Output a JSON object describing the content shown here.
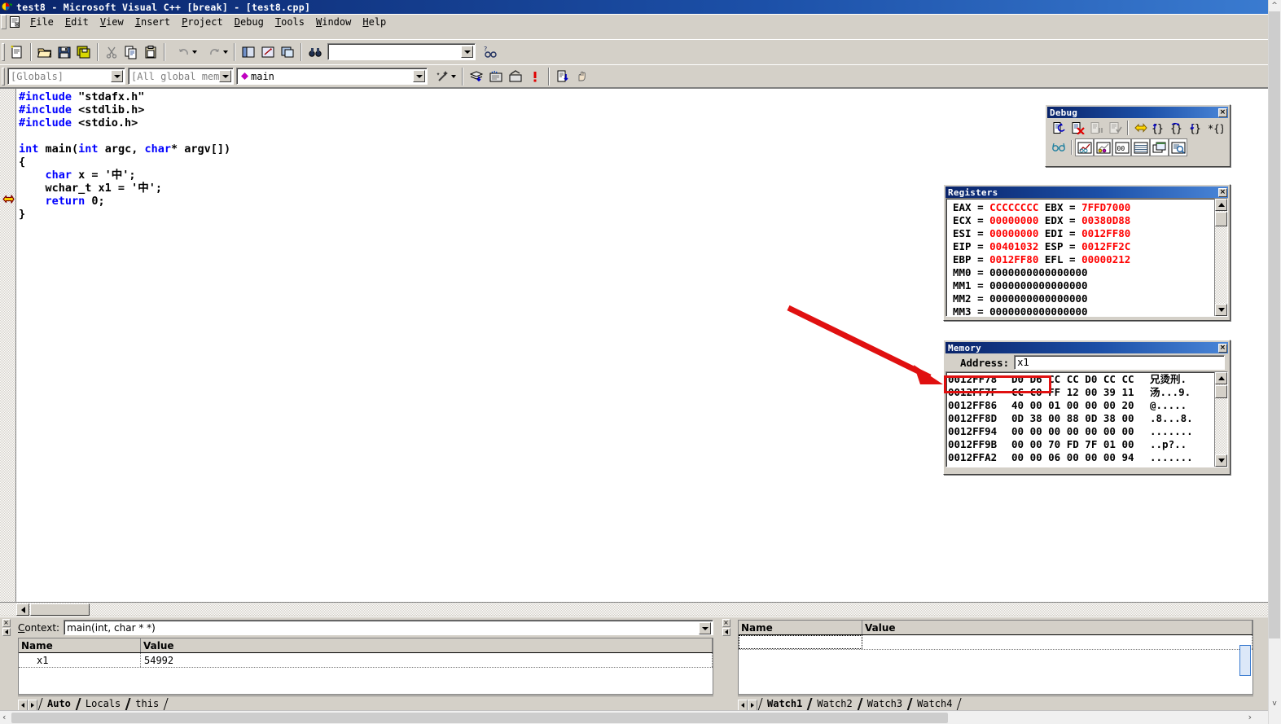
{
  "window": {
    "title": "test8 - Microsoft Visual C++ [break] - [test8.cpp]",
    "app_icon": "vcpp-icon",
    "close_label": "×"
  },
  "menu": {
    "doc_icon": "document-icon",
    "items": [
      {
        "label": "File",
        "mnemonic": "F"
      },
      {
        "label": "Edit",
        "mnemonic": "E"
      },
      {
        "label": "View",
        "mnemonic": "V"
      },
      {
        "label": "Insert",
        "mnemonic": "I"
      },
      {
        "label": "Project",
        "mnemonic": "P"
      },
      {
        "label": "Debug",
        "mnemonic": "D"
      },
      {
        "label": "Tools",
        "mnemonic": "T"
      },
      {
        "label": "Window",
        "mnemonic": "W"
      },
      {
        "label": "Help",
        "mnemonic": "H"
      }
    ]
  },
  "toolbar_standard": {
    "buttons": [
      {
        "name": "new-file-button",
        "icon": "new-document-icon"
      },
      {
        "name": "open-file-button",
        "icon": "open-folder-icon"
      },
      {
        "name": "save-button",
        "icon": "floppy-disk-icon"
      },
      {
        "name": "save-all-button",
        "icon": "save-all-icon"
      },
      {
        "name": "cut-button",
        "icon": "scissors-icon"
      },
      {
        "name": "copy-button",
        "icon": "copy-icon"
      },
      {
        "name": "paste-button",
        "icon": "clipboard-paste-icon"
      },
      {
        "name": "undo-button",
        "icon": "undo-arrow-icon"
      },
      {
        "name": "redo-button",
        "icon": "redo-arrow-icon"
      },
      {
        "name": "workspace-button",
        "icon": "workspace-icon"
      },
      {
        "name": "output-button",
        "icon": "output-window-icon"
      },
      {
        "name": "window-list-button",
        "icon": "window-list-icon"
      },
      {
        "name": "find-in-files-button",
        "icon": "binoculars-icon"
      }
    ],
    "find_box": {
      "value": "",
      "placeholder": ""
    },
    "help_button": {
      "name": "find-help-button",
      "icon": "help-search-icon"
    }
  },
  "toolbar_wizardbar": {
    "globals_combo": {
      "value": "[Globals]"
    },
    "members_combo": {
      "value": "[All global members"
    },
    "function_combo": {
      "value": "main",
      "icon": "member-function-icon"
    },
    "wizard_button": {
      "name": "wizard-button",
      "icon": "magic-wand-icon"
    },
    "buttons": [
      {
        "name": "compile-button",
        "icon": "compile-icon"
      },
      {
        "name": "build-button",
        "icon": "build-icon"
      },
      {
        "name": "stop-build-button",
        "icon": "stop-build-icon"
      },
      {
        "name": "execute-program-button",
        "icon": "exclamation-icon"
      },
      {
        "name": "go-button",
        "icon": "go-debug-icon"
      },
      {
        "name": "insert-breakpoint-button",
        "icon": "hand-icon"
      }
    ]
  },
  "editor": {
    "current_line_marker": "yellow-arrow-icon",
    "lines": [
      [
        {
          "t": "#include",
          "c": "kw"
        },
        {
          "t": " \"stdafx.h\"",
          "c": ""
        }
      ],
      [
        {
          "t": "#include",
          "c": "kw"
        },
        {
          "t": " <stdlib.h>",
          "c": ""
        }
      ],
      [
        {
          "t": "#include",
          "c": "kw"
        },
        {
          "t": " <stdio.h>",
          "c": ""
        }
      ],
      [
        {
          "t": "",
          "c": ""
        }
      ],
      [
        {
          "t": "int",
          "c": "kw"
        },
        {
          "t": " main(",
          "c": ""
        },
        {
          "t": "int",
          "c": "kw"
        },
        {
          "t": " argc, ",
          "c": ""
        },
        {
          "t": "char",
          "c": "kw"
        },
        {
          "t": "* argv[])",
          "c": ""
        }
      ],
      [
        {
          "t": "{",
          "c": ""
        }
      ],
      [
        {
          "t": "    ",
          "c": ""
        },
        {
          "t": "char",
          "c": "kw"
        },
        {
          "t": " x = '中';",
          "c": ""
        }
      ],
      [
        {
          "t": "    wchar_t x1 = '中';",
          "c": ""
        }
      ],
      [
        {
          "t": "    ",
          "c": ""
        },
        {
          "t": "return",
          "c": "kw"
        },
        {
          "t": " 0;",
          "c": ""
        }
      ],
      [
        {
          "t": "}",
          "c": ""
        }
      ]
    ]
  },
  "debug_toolbar": {
    "title": "Debug",
    "close_label": "×",
    "row1": [
      {
        "name": "restart-button",
        "icon": "restart-debug-icon"
      },
      {
        "name": "stop-debugging-button",
        "icon": "stop-debug-icon"
      },
      {
        "name": "break-execution-button",
        "icon": "break-execution-icon"
      },
      {
        "name": "apply-code-changes-button",
        "icon": "apply-code-changes-icon"
      },
      {
        "name": "step-continue-button",
        "icon": "yellow-arrow-icon"
      },
      {
        "name": "step-into-button",
        "icon": "step-into-icon"
      },
      {
        "name": "step-over-button",
        "icon": "step-over-icon"
      },
      {
        "name": "step-out-button",
        "icon": "step-out-icon"
      },
      {
        "name": "run-to-cursor-button",
        "icon": "run-to-cursor-icon"
      }
    ],
    "row2": [
      {
        "name": "quickwatch-button",
        "icon": "glasses-icon"
      },
      {
        "name": "watch-window-button",
        "icon": "watch-window-icon"
      },
      {
        "name": "variables-window-button",
        "icon": "variables-window-icon"
      },
      {
        "name": "registers-window-button",
        "icon": "registers-window-icon"
      },
      {
        "name": "memory-window-button",
        "icon": "memory-window-icon"
      },
      {
        "name": "call-stack-button",
        "icon": "call-stack-icon"
      },
      {
        "name": "disassembly-button",
        "icon": "disassembly-icon"
      }
    ]
  },
  "registers": {
    "title": "Registers",
    "close_label": "×",
    "pairs": [
      {
        "n1": "EAX",
        "v1": "CCCCCCCC",
        "n2": "EBX",
        "v2": "7FFD7000"
      },
      {
        "n1": "ECX",
        "v1": "00000000",
        "n2": "EDX",
        "v2": "00380D88"
      },
      {
        "n1": "ESI",
        "v1": "00000000",
        "n2": "EDI",
        "v2": "0012FF80"
      },
      {
        "n1": "EIP",
        "v1": "00401032",
        "n2": "ESP",
        "v2": "0012FF2C"
      },
      {
        "n1": "EBP",
        "v1": "0012FF80",
        "n2": "EFL",
        "v2": "00000212"
      }
    ],
    "mm": [
      {
        "n": "MM0",
        "v": "0000000000000000"
      },
      {
        "n": "MM1",
        "v": "0000000000000000"
      },
      {
        "n": "MM2",
        "v": "0000000000000000"
      },
      {
        "n": "MM3",
        "v": "0000000000000000"
      }
    ],
    "value_color": "#ff0000"
  },
  "memory": {
    "title": "Memory",
    "close_label": "×",
    "address_label": "Address:",
    "address_value": "x1",
    "rows": [
      {
        "addr": "0012FF78",
        "hex": "D0 D6 CC CC D0 CC CC",
        "ascii": "兄烫刑."
      },
      {
        "addr": "0012FF7F",
        "hex": "CC C0 FF 12 00 39 11",
        "ascii": "汤...9."
      },
      {
        "addr": "0012FF86",
        "hex": "40 00 01 00 00 00 20",
        "ascii": "@....."
      },
      {
        "addr": "0012FF8D",
        "hex": "0D 38 00 88 0D 38 00",
        "ascii": ".8...8."
      },
      {
        "addr": "0012FF94",
        "hex": "00 00 00 00 00 00 00",
        "ascii": "......."
      },
      {
        "addr": "0012FF9B",
        "hex": "00 00 70 FD 7F 01 00",
        "ascii": "..p?.."
      },
      {
        "addr": "0012FFA2",
        "hex": "00 00 06 00 00 00 94",
        "ascii": "......."
      }
    ]
  },
  "annotation": {
    "color": "#e01010",
    "highlight_target": "0012FF78  D0 D6",
    "arrow_name": "red-pointer-arrow"
  },
  "variables_window": {
    "context_label": "Context:",
    "context_value": "main(int, char * *)",
    "columns": [
      "Name",
      "Value"
    ],
    "rows": [
      {
        "name": "x1",
        "value": "54992"
      }
    ],
    "tabs": [
      "Auto",
      "Locals",
      "this"
    ],
    "active_tab": "Auto",
    "close_label": "×"
  },
  "watch_window": {
    "columns": [
      "Name",
      "Value"
    ],
    "rows": [
      {
        "name": "",
        "value": ""
      }
    ],
    "tabs": [
      "Watch1",
      "Watch2",
      "Watch3",
      "Watch4"
    ],
    "active_tab": "Watch1",
    "close_label": "×"
  }
}
